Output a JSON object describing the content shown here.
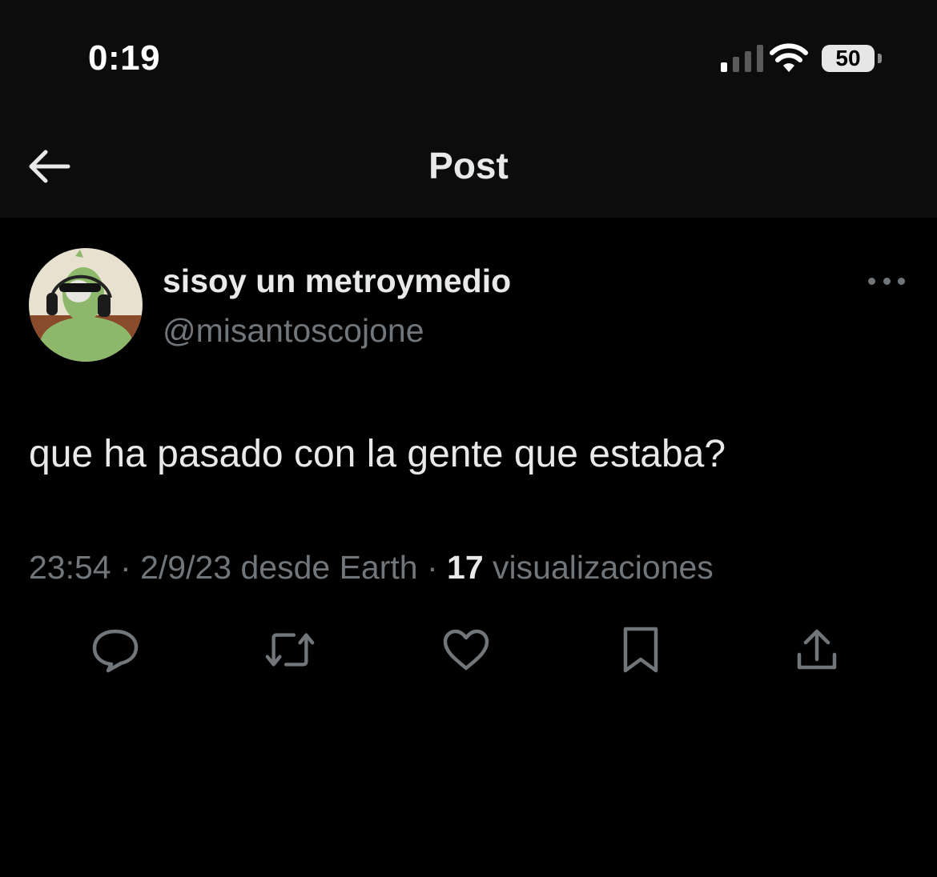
{
  "status_bar": {
    "time": "0:19",
    "battery": "50",
    "icons": [
      "cellular-signal-icon",
      "wifi-icon",
      "battery-icon"
    ]
  },
  "nav": {
    "title": "Post",
    "back_icon": "arrow-left-icon"
  },
  "tweet": {
    "author": {
      "display_name": "sisoy un metroymedio",
      "handle": "@misantoscojone"
    },
    "text": "que ha pasado con la gente que estaba?",
    "meta": {
      "time": "23:54",
      "separator": "·",
      "date": "2/9/23",
      "source": "desde Earth",
      "views_count": "17",
      "views_label": "visualizaciones"
    },
    "actions": [
      "reply-icon",
      "retweet-icon",
      "like-icon",
      "bookmark-icon",
      "share-icon"
    ]
  },
  "colors": {
    "background": "#000000",
    "header_background": "#0c0c0c",
    "primary_text": "#e7e9ea",
    "secondary_text": "#71767b"
  }
}
